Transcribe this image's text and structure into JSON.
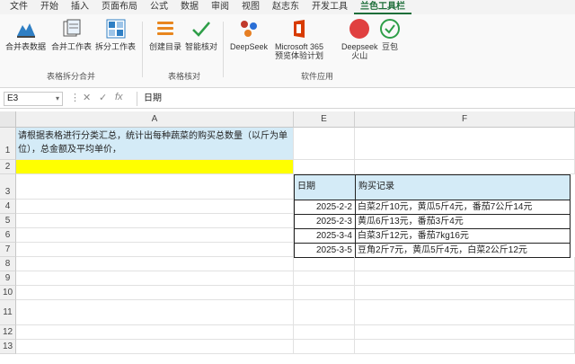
{
  "menu": [
    "文件",
    "开始",
    "插入",
    "页面布局",
    "公式",
    "数据",
    "审阅",
    "视图",
    "赵志东",
    "开发工具",
    "兰色工具栏"
  ],
  "menu_active_index": 10,
  "ribbon": {
    "group1": {
      "buttons": [
        "合并表数据",
        "合并工作表",
        "拆分工作表"
      ],
      "label": "表格拆分合并"
    },
    "group2": {
      "buttons": [
        "创建目录",
        "智能核对"
      ],
      "label": "表格核对"
    },
    "group3": {
      "buttons": [
        "DeepSeek",
        "Microsoft 365\n预览体验计划",
        "Deepseek\n火山",
        "豆包"
      ],
      "label": "软件应用"
    }
  },
  "formula_bar": {
    "name_box": "E3",
    "cancel": "✕",
    "enter": "✓",
    "fx": "fx",
    "content": "日期"
  },
  "columns": [
    "A",
    "E",
    "F"
  ],
  "rows": [
    "1",
    "2",
    "3",
    "4",
    "5",
    "6",
    "7",
    "8",
    "9",
    "10",
    "11",
    "12",
    "13"
  ],
  "cells": {
    "A1": "请根据表格进行分类汇总，统计出每种蔬菜的购买总数量（以斤为单位），总金额及平均单价，",
    "E3": "日期",
    "F3": "购买记录",
    "table": [
      {
        "date": "2025-2-2",
        "record": "白菜2斤10元，黄瓜5斤4元，番茄7公斤14元"
      },
      {
        "date": "2025-2-3",
        "record": "黄瓜6斤13元，番茄3斤4元"
      },
      {
        "date": "2025-3-4",
        "record": "白菜3斤12元，番茄7kg16元"
      },
      {
        "date": "2025-3-5",
        "record": "豆角2斤7元，黄瓜5斤4元，白菜2公斤12元"
      }
    ]
  },
  "colors": {
    "accent": "#1e6e3a",
    "highlight_blue": "#d4ebf7",
    "highlight_yellow": "#ffff00"
  }
}
